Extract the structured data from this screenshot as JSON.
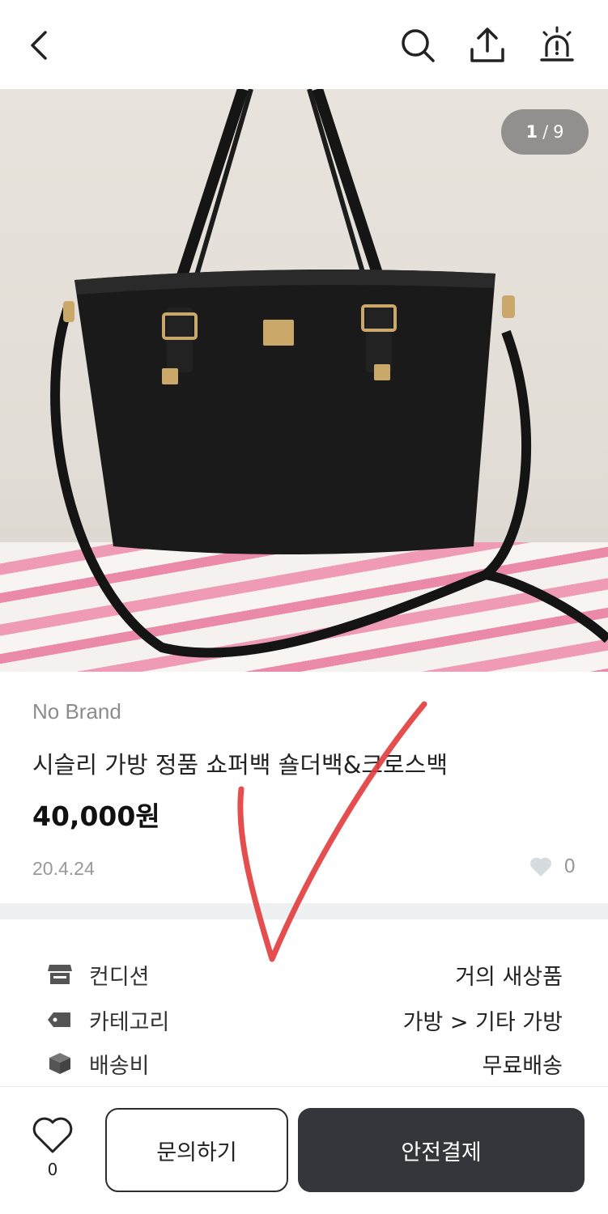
{
  "header": {
    "back_icon": "chevron-left-icon",
    "search_icon": "search-icon",
    "share_icon": "share-icon",
    "report_icon": "alarm-siren-icon"
  },
  "gallery": {
    "current": "1",
    "separator": "/",
    "total": "9"
  },
  "product": {
    "brand": "No Brand",
    "title": "시슬리 가방 정품 쇼퍼백 숄더백&크로스백",
    "price": "40,000원",
    "date": "20.4.24",
    "like_count": "0"
  },
  "specs": [
    {
      "icon": "store-icon",
      "label": "컨디션",
      "value": "거의 새상품"
    },
    {
      "icon": "tag-icon",
      "label": "카테고리",
      "value": "가방 > 기타 가방"
    },
    {
      "icon": "box-icon",
      "label": "배송비",
      "value": "무료배송"
    }
  ],
  "bottom": {
    "wish_count": "0",
    "ask_label": "문의하기",
    "pay_label": "안전결제"
  },
  "colors": {
    "pay_button": "#33363a",
    "annotation": "#e23b3b",
    "muted_text": "#999999"
  }
}
